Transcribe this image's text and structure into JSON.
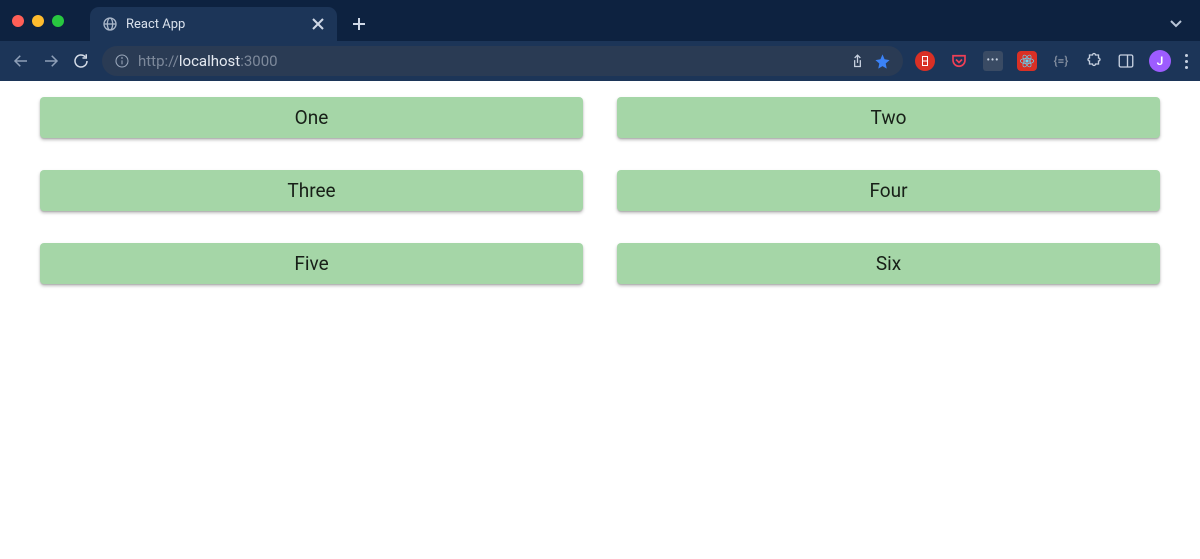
{
  "browser": {
    "tab_title": "React App",
    "url_scheme": "http://",
    "url_host": "localhost",
    "url_port": ":3000",
    "avatar_initial": "J"
  },
  "cards": {
    "0": "One",
    "1": "Two",
    "2": "Three",
    "3": "Four",
    "4": "Five",
    "5": "Six"
  },
  "colors": {
    "card_bg": "#a5d6a7",
    "chrome_bg": "#0d2240",
    "toolbar_bg": "#1c3558"
  }
}
